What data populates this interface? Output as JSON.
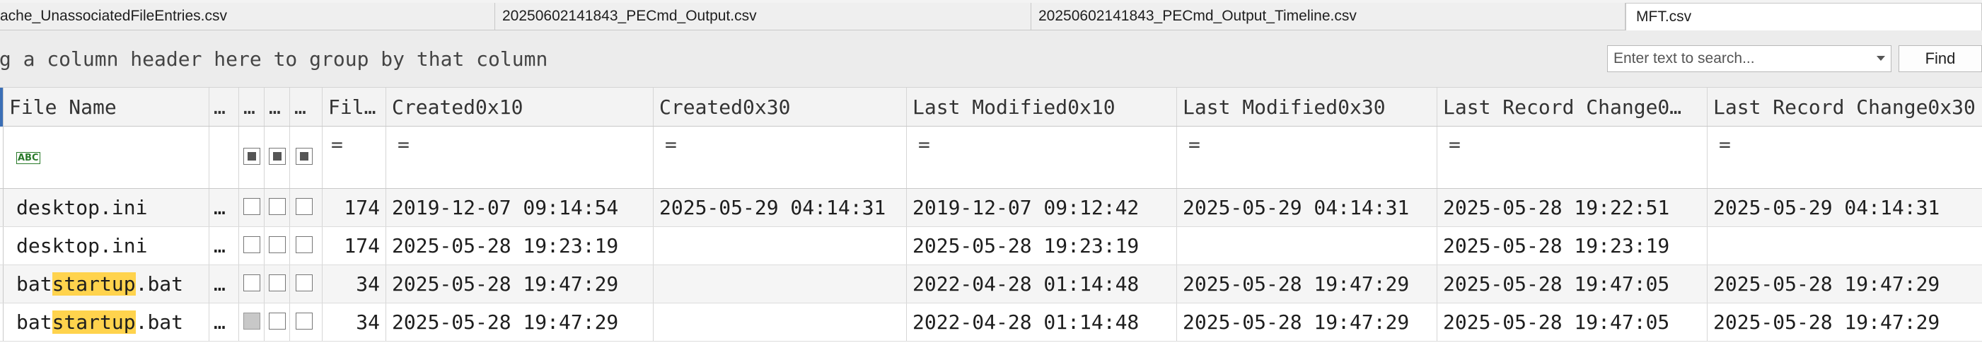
{
  "tabs": [
    {
      "label": "ache_UnassociatedFileEntries.csv",
      "active": false
    },
    {
      "label": "20250602141843_PECmd_Output.csv",
      "active": false
    },
    {
      "label": "20250602141843_PECmd_Output_Timeline.csv",
      "active": false
    },
    {
      "label": "MFT.csv",
      "active": true
    }
  ],
  "group_hint": "ag a column header here to group by that column",
  "search": {
    "placeholder": "Enter text to search...",
    "find_label": "Find"
  },
  "columns": {
    "file_name": "File Name",
    "c1": "…",
    "c2": "…",
    "c3": "…",
    "c4": "…",
    "file_size": "Fil…",
    "created10": "Created0x10",
    "created30": "Created0x30",
    "lastmod10": "Last Modified0x10",
    "lastmod30": "Last Modified0x30",
    "lastrec10": "Last Record Change0…",
    "lastrec30": "Last Record Change0x30"
  },
  "filter": {
    "eq": "="
  },
  "rows": [
    {
      "name_pre": "desktop.ini",
      "name_hl": "",
      "name_post": "",
      "dots": "…",
      "size": "174",
      "created10": "2019-12-07 09:14:54",
      "created30": "2025-05-29 04:14:31",
      "lastmod10": "2019-12-07 09:12:42",
      "lastmod30": "2025-05-29 04:14:31",
      "lastrec10": "2025-05-28 19:22:51",
      "lastrec30": "2025-05-29 04:14:31"
    },
    {
      "name_pre": "desktop.ini",
      "name_hl": "",
      "name_post": "",
      "dots": "…",
      "size": "174",
      "created10": "2025-05-28 19:23:19",
      "created30": "",
      "lastmod10": "2025-05-28 19:23:19",
      "lastmod30": "",
      "lastrec10": "2025-05-28 19:23:19",
      "lastrec30": ""
    },
    {
      "name_pre": "bat",
      "name_hl": "startup",
      "name_post": ".bat",
      "dots": "…",
      "size": "34",
      "created10": "2025-05-28 19:47:29",
      "created30": "",
      "lastmod10": "2022-04-28 01:14:48",
      "lastmod30": "2025-05-28 19:47:29",
      "lastrec10": "2025-05-28 19:47:05",
      "lastrec30": "2025-05-28 19:47:29"
    },
    {
      "name_pre": "bat",
      "name_hl": "startup",
      "name_post": ".bat",
      "dots": "…",
      "size": "34",
      "created10": "2025-05-28 19:47:29",
      "created30": "",
      "lastmod10": "2022-04-28 01:14:48",
      "lastmod30": "2025-05-28 19:47:29",
      "lastrec10": "2025-05-28 19:47:05",
      "lastrec30": "2025-05-28 19:47:29"
    }
  ]
}
